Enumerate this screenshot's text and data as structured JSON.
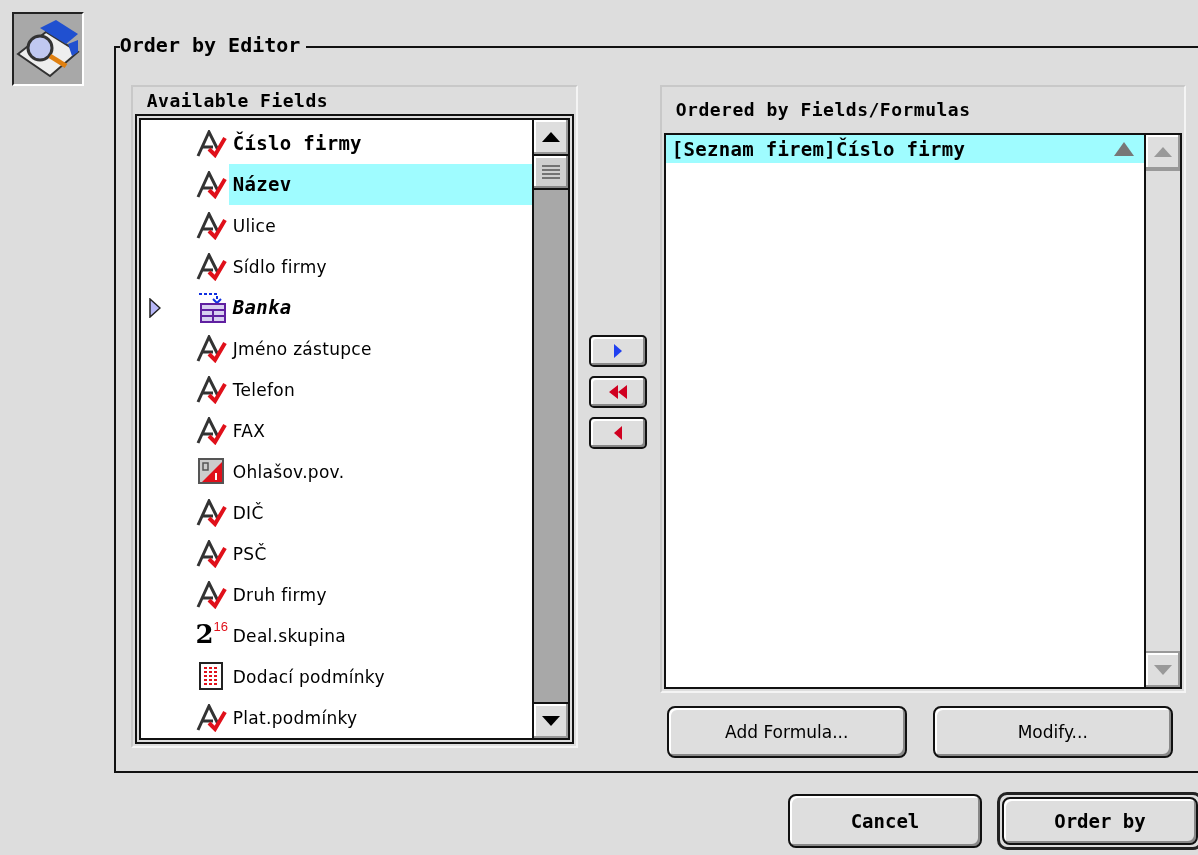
{
  "dialog": {
    "title": "Order by Editor"
  },
  "available_fields": {
    "heading": "Available Fields",
    "items": [
      {
        "label": "Číslo firmy",
        "kind": "text",
        "indexed": true,
        "selected": false
      },
      {
        "label": "Název",
        "kind": "text",
        "indexed": true,
        "selected": true
      },
      {
        "label": "Ulice",
        "kind": "text",
        "indexed": false,
        "selected": false
      },
      {
        "label": "Sídlo firmy",
        "kind": "text",
        "indexed": false,
        "selected": false
      },
      {
        "label": "Banka",
        "kind": "relation",
        "indexed": true,
        "selected": false,
        "expanded": false
      },
      {
        "label": "Jméno zástupce",
        "kind": "text",
        "indexed": false,
        "selected": false
      },
      {
        "label": "Telefon",
        "kind": "text",
        "indexed": false,
        "selected": false
      },
      {
        "label": "FAX",
        "kind": "text",
        "indexed": false,
        "selected": false
      },
      {
        "label": "Ohlašov.pov.",
        "kind": "boolean",
        "indexed": false,
        "selected": false
      },
      {
        "label": "DIČ",
        "kind": "text",
        "indexed": false,
        "selected": false
      },
      {
        "label": "PSČ",
        "kind": "text",
        "indexed": false,
        "selected": false
      },
      {
        "label": "Druh firmy",
        "kind": "text",
        "indexed": false,
        "selected": false
      },
      {
        "label": "Deal.skupina",
        "kind": "integer",
        "indexed": false,
        "selected": false,
        "icon_base": "2",
        "icon_power": "16"
      },
      {
        "label": "Dodací podmínky",
        "kind": "memo",
        "indexed": false,
        "selected": false
      },
      {
        "label": "Plat.podmínky",
        "kind": "text",
        "indexed": false,
        "selected": false
      }
    ]
  },
  "ordered_fields": {
    "heading": "Ordered by Fields/Formulas",
    "items": [
      {
        "label": "[Seznam firem]Číslo firmy",
        "ascending": true,
        "selected": true
      }
    ]
  },
  "formula_buttons": [
    "Add Formula...",
    "Modify..."
  ],
  "dialog_buttons": [
    {
      "label": "Cancel",
      "default": false
    },
    {
      "label": "Order by",
      "default": true
    }
  ]
}
